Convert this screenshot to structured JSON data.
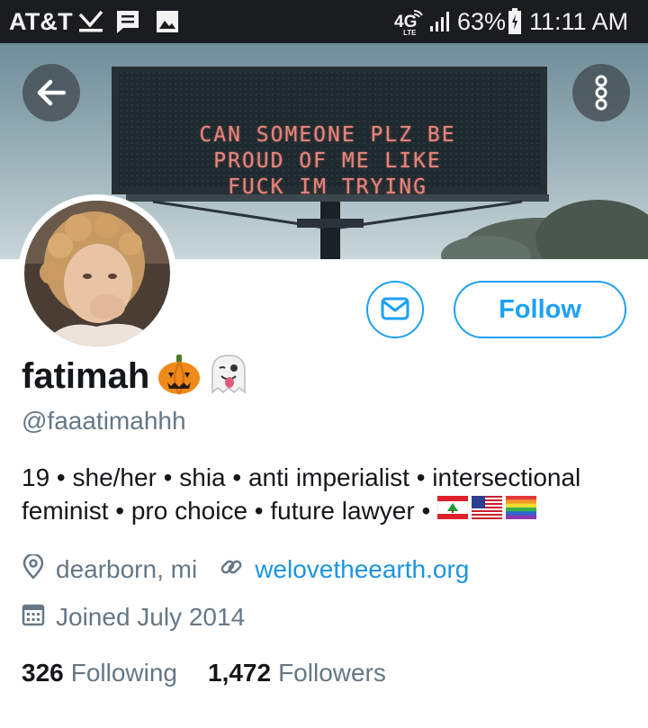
{
  "status_bar": {
    "carrier": "AT&T",
    "network": "4G",
    "network_sub": "LTE",
    "battery_percent": "63%",
    "time": "11:11 AM"
  },
  "banner": {
    "sign_lines": [
      "CAN SOMEONE PLZ BE",
      "PROUD OF ME LIKE",
      "FUCK IM TRYING"
    ]
  },
  "profile": {
    "name": "fatimah",
    "handle": "@faaatimahhh",
    "follow_label": "Follow",
    "bio_line_1": "19 • she/her • shia • anti imperialist • intersectional",
    "bio_line_2": "feminist • pro choice • future lawyer •",
    "location": "dearborn, mi",
    "website": "welovetheearth.org",
    "joined": "Joined July 2014"
  },
  "stats": {
    "following_count": "326",
    "following_label": "Following",
    "followers_count": "1,472",
    "followers_label": "Followers"
  },
  "icons": [
    "check-download-icon",
    "message-icon",
    "image-icon",
    "wifi-icon",
    "signal-icon",
    "battery-icon",
    "back-arrow-icon",
    "more-options-icon",
    "envelope-icon",
    "pumpkin-emoji-icon",
    "ghost-emoji-icon",
    "lebanon-flag-icon",
    "us-flag-icon",
    "rainbow-flag-icon",
    "location-pin-icon",
    "link-icon",
    "calendar-icon"
  ],
  "colors": {
    "accent": "#1da1f2",
    "link": "#1b95e0",
    "secondary_text": "#657786",
    "status_bar": "#1b1c20"
  }
}
